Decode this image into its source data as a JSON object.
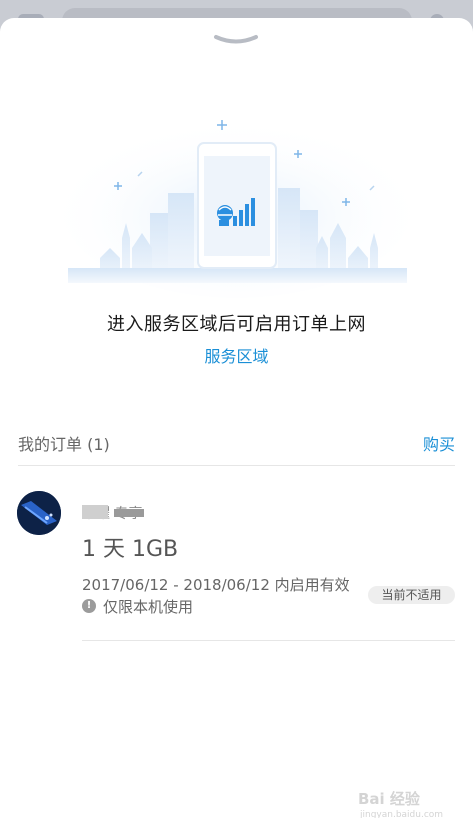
{
  "sheet": {
    "empty_message": "进入服务区域后可启用订单上网",
    "region_link": "服务区域"
  },
  "orders": {
    "title": "我的订单 (1)",
    "buy_label": "购买",
    "items": [
      {
        "brand": "荣耀    专享",
        "plan": "1 天 1GB",
        "validity": "2017/06/12 - 2018/06/12 内启用有效",
        "note": "仅限本机使用",
        "status": "当前不适用"
      }
    ]
  },
  "watermark": {
    "text": "Bai 经验",
    "url": "jingyan.baidu.com"
  },
  "colors": {
    "accent": "#1a8fd6",
    "badge_bg": "#eeeeee",
    "text_primary": "#1a1a1a",
    "text_secondary": "#666666"
  },
  "icons": {
    "handle": "chevron-down-icon",
    "signal": "signal-globe-icon",
    "warning": "exclamation-icon"
  }
}
